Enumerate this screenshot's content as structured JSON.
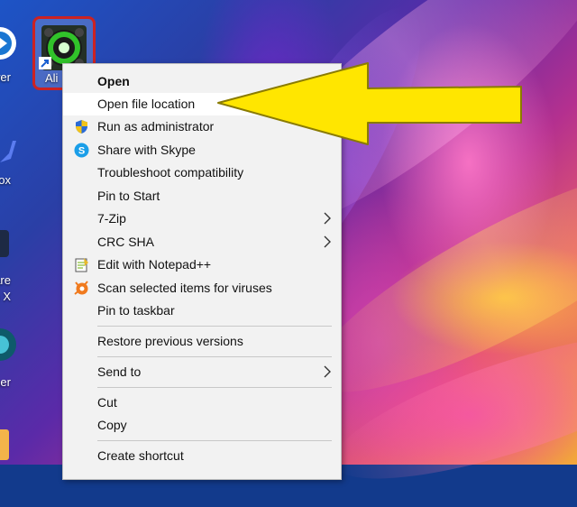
{
  "desktop": {
    "left_labels": [
      "wer",
      "ox",
      "hare",
      "n X",
      "ner"
    ],
    "selected_app": {
      "label": "Ali",
      "icon": "green-ring-app-icon"
    }
  },
  "context_menu": {
    "items": [
      {
        "label": "Open",
        "bold": true,
        "icon": ""
      },
      {
        "label": "Open file location",
        "hover": true,
        "icon": ""
      },
      {
        "label": "Run as administrator",
        "icon": "uac-shield-icon"
      },
      {
        "label": "Share with Skype",
        "icon": "skype-icon"
      },
      {
        "label": "Troubleshoot compatibility",
        "icon": ""
      },
      {
        "label": "Pin to Start",
        "icon": ""
      },
      {
        "label": "7-Zip",
        "submenu": true,
        "icon": ""
      },
      {
        "label": "CRC SHA",
        "submenu": true,
        "icon": ""
      },
      {
        "label": "Edit with Notepad++",
        "icon": "notepadpp-icon"
      },
      {
        "label": "Scan selected items for viruses",
        "icon": "avast-icon"
      },
      {
        "label": "Pin to taskbar",
        "icon": ""
      },
      {
        "label": "Restore previous versions",
        "icon": ""
      },
      {
        "label": "Send to",
        "submenu": true,
        "icon": ""
      },
      {
        "label": "Cut",
        "icon": ""
      },
      {
        "label": "Copy",
        "icon": ""
      },
      {
        "label": "Create shortcut",
        "icon": ""
      }
    ]
  },
  "annotation": {
    "type": "arrow",
    "color": "#ffe600",
    "outline": "#8a7b00"
  }
}
